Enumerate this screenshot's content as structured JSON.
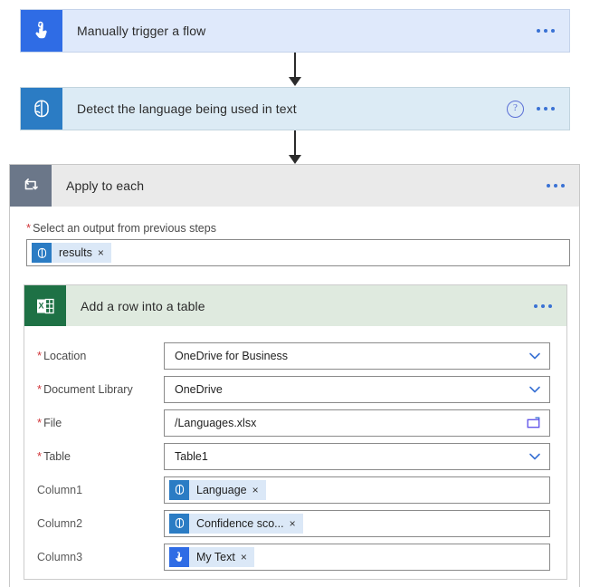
{
  "flow": {
    "nodes": [
      {
        "id": "trigger",
        "title": "Manually trigger a flow",
        "icon": "tap-hand-icon",
        "has_help": false,
        "menu": "overflow-menu-icon"
      },
      {
        "id": "detect",
        "title": "Detect the language being used in text",
        "icon": "text-analytics-brain-icon",
        "has_help": true,
        "help_label": "?",
        "menu": "overflow-menu-icon"
      }
    ],
    "loop": {
      "title": "Apply to each",
      "icon": "loop-repeat-icon",
      "output_label": "Select an output from previous steps",
      "output_required": "*",
      "output_token": {
        "label": "results",
        "icon": "text-analytics-brain-icon",
        "remove": "×"
      }
    },
    "excel": {
      "title": "Add a row into a table",
      "icon": "excel-table-icon",
      "fields": [
        {
          "label": "Location",
          "required": true,
          "value": "OneDrive for Business",
          "control": "dropdown"
        },
        {
          "label": "Document Library",
          "required": true,
          "value": "OneDrive",
          "control": "dropdown"
        },
        {
          "label": "File",
          "required": true,
          "value": "/Languages.xlsx",
          "control": "folder-picker"
        },
        {
          "label": "Table",
          "required": true,
          "value": "Table1",
          "control": "dropdown"
        }
      ],
      "columns": [
        {
          "label": "Column1",
          "required": false,
          "token": {
            "label": "Language",
            "icon": "text-analytics-brain-icon",
            "remove": "×"
          }
        },
        {
          "label": "Column2",
          "required": false,
          "token": {
            "label": "Confidence sco...",
            "icon": "text-analytics-brain-icon",
            "remove": "×"
          }
        },
        {
          "label": "Column3",
          "required": false,
          "token": {
            "label": "My Text",
            "icon": "tap-hand-icon",
            "remove": "×"
          }
        }
      ]
    }
  },
  "colors": {
    "trigger_bg": "#dfe9fb",
    "trigger_icon_bg": "#2f6ce5",
    "detect_bg": "#dcebf5",
    "detect_icon_bg": "#2b7cc4",
    "loop_header_bg": "#eaeaea",
    "loop_icon_bg": "#6b7789",
    "excel_header_bg": "#dfeadf",
    "excel_icon_bg": "#1e7145",
    "accent_blue": "#3a72d4",
    "required_red": "#d13438",
    "token_chip_bg": "#dbe8f7"
  }
}
